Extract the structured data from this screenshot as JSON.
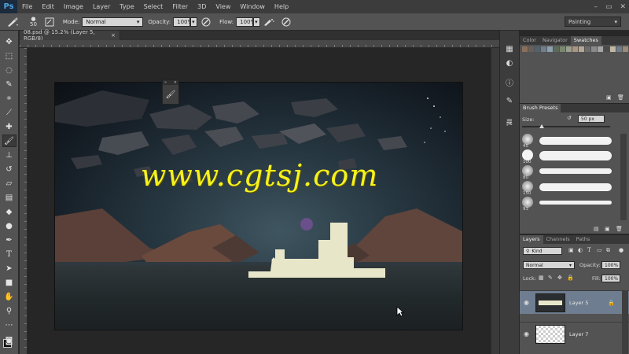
{
  "menubar": {
    "logo": "Ps",
    "items": [
      "File",
      "Edit",
      "Image",
      "Layer",
      "Type",
      "Select",
      "Filter",
      "3D",
      "View",
      "Window",
      "Help"
    ],
    "window_controls": [
      "–",
      "▭",
      "✕"
    ]
  },
  "options": {
    "brush_size": "50",
    "mode_label": "Mode:",
    "mode_value": "Normal",
    "opacity_label": "Opacity:",
    "opacity_value": "100%",
    "flow_label": "Flow:",
    "flow_value": "100%",
    "workspace": "Painting"
  },
  "document": {
    "tab_title": "08.psd @ 15.2% (Layer 5, RGB/8)",
    "tab_close": "×"
  },
  "canvas": {
    "watermark": "www.cgtsj.com"
  },
  "float_panel": {
    "head_left": "»",
    "head_right": "×"
  },
  "swatches_panel": {
    "tabs": [
      "Color",
      "Navigator",
      "Swatches"
    ],
    "active_tab": "Swatches",
    "colors": [
      "#8a6f5c",
      "#6b5f55",
      "#4f6270",
      "#6f7f8f",
      "#8ea0b0",
      "#5d6a59",
      "#7a8870",
      "#9aa090",
      "#a99582",
      "#b7a792",
      "#6b6b6b",
      "#8a8a8a",
      "#a5a5a5",
      "#4b4b4b",
      "#c2b7a4",
      "#707e88",
      "#9b8b7b",
      "#56606a"
    ]
  },
  "brush_presets": {
    "tab": "Brush Presets",
    "size_label": "Size:",
    "size_value": "50 px",
    "presets": [
      {
        "num": "45"
      },
      {
        "num": "100"
      },
      {
        "num": "80"
      },
      {
        "num": "150"
      },
      {
        "num": "93"
      }
    ]
  },
  "layers_panel": {
    "tabs": [
      "Layers",
      "Channels",
      "Paths"
    ],
    "active_tab": "Layers",
    "filter_label": "Kind",
    "blend_mode": "Normal",
    "opacity_label": "Opacity:",
    "opacity_value": "100%",
    "lock_label": "Lock:",
    "fill_label": "Fill:",
    "fill_value": "100%",
    "layers": [
      {
        "name": "Layer 5",
        "selected": true
      },
      {
        "name": "Layer 7",
        "selected": false
      }
    ]
  }
}
